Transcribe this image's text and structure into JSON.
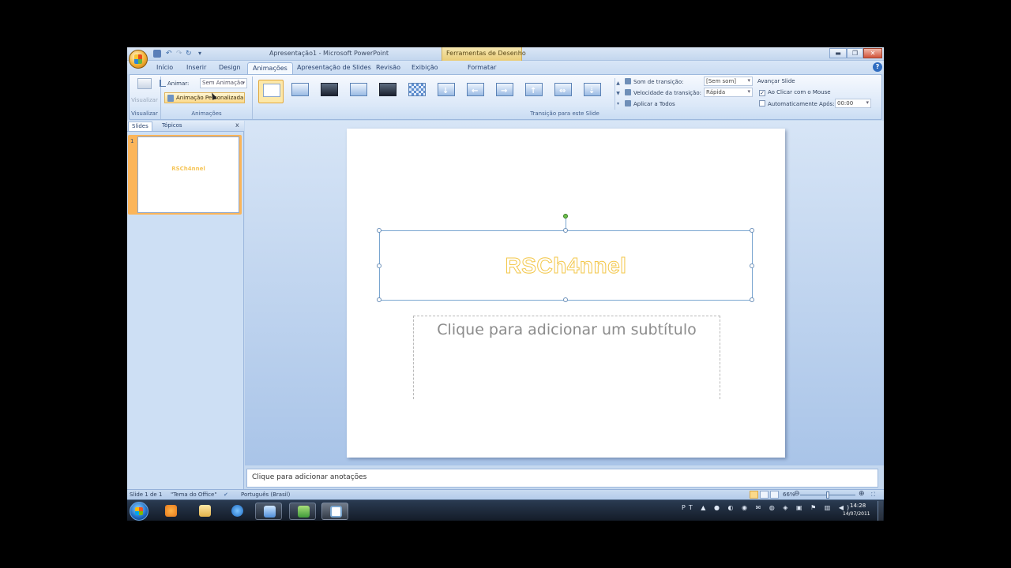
{
  "window": {
    "title": "Apresentação1 - Microsoft PowerPoint",
    "context_tab_group": "Ferramentas de Desenho",
    "min_label": "▬",
    "max_label": "❐",
    "close_label": "✕"
  },
  "tabs": [
    {
      "label": "Início"
    },
    {
      "label": "Inserir"
    },
    {
      "label": "Design"
    },
    {
      "label": "Animações",
      "active": true
    },
    {
      "label": "Apresentação de Slides"
    },
    {
      "label": "Revisão"
    },
    {
      "label": "Exibição"
    },
    {
      "label": "Formatar"
    }
  ],
  "ribbon": {
    "visualizar": {
      "button_label": "Visualizar",
      "group_label": "Visualizar"
    },
    "animacoes": {
      "animar_label": "Animar:",
      "animar_value": "Sem Animação",
      "custom_button": "Animação Personalizada",
      "group_label": "Animações"
    },
    "transicao": {
      "group_label": "Transição para este Slide",
      "som_label": "Som de transição:",
      "som_value": "[Sem som]",
      "velocidade_label": "Velocidade da transição:",
      "velocidade_value": "Rápida",
      "aplicar_label": "Aplicar a Todos",
      "avancar_title": "Avançar Slide",
      "ao_clicar_label": "Ao Clicar com o Mouse",
      "ao_clicar_checked": true,
      "auto_label": "Automaticamente Após:",
      "auto_checked": false,
      "auto_value": "00:00",
      "gallery_up": "▲",
      "gallery_down": "▼",
      "gallery_more": "▾"
    }
  },
  "left_panel": {
    "tab_slides": "Slides",
    "tab_topicos": "Tópicos",
    "close": "x",
    "slide_number": "1",
    "thumb_title": "RSCh4nnel"
  },
  "slide": {
    "title": "RSCh4nnel",
    "subtitle_placeholder": "Clique para adicionar um subtítulo"
  },
  "notes": {
    "placeholder": "Clique para adicionar anotações"
  },
  "status": {
    "slide_info": "Slide 1 de 1",
    "theme": "\"Tema do Office\"",
    "language": "Português (Brasil)",
    "zoom": "66%",
    "zoom_minus": "⊖",
    "zoom_plus": "⊕"
  },
  "taskbar": {
    "time": "14:28",
    "date": "14/07/2011",
    "tray": "PT ▲ ● ◐ ◉ ✉ ◍ ◈ ▣ ⚑ ▥ ◀)"
  }
}
